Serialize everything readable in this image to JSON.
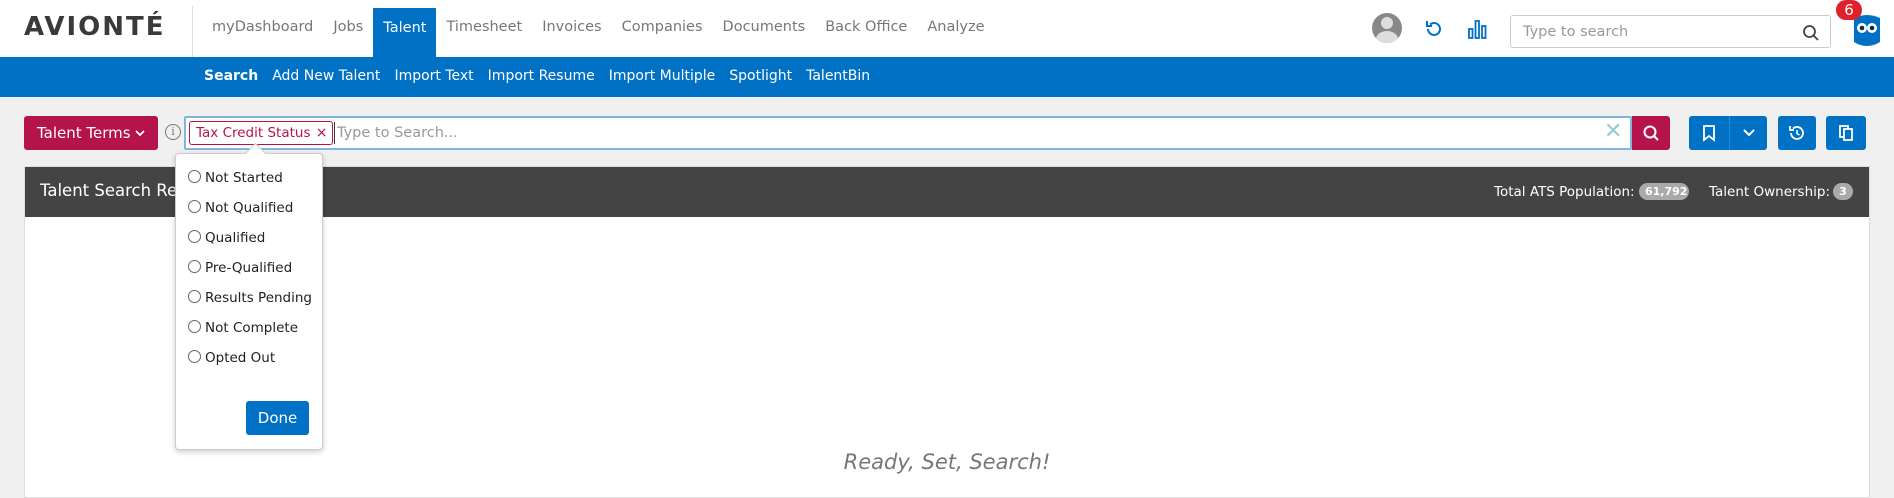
{
  "app": {
    "logo": "AVIONTÉ"
  },
  "nav": {
    "items": [
      "myDashboard",
      "Jobs",
      "Talent",
      "Timesheet",
      "Invoices",
      "Companies",
      "Documents",
      "Back Office",
      "Analyze"
    ],
    "active": "Talent"
  },
  "top_search": {
    "placeholder": "Type to search"
  },
  "notifications": {
    "count": "6"
  },
  "subnav": {
    "items": [
      "Search",
      "Add New Talent",
      "Import Text",
      "Import Resume",
      "Import Multiple",
      "Spotlight",
      "TalentBin"
    ],
    "active": "Search"
  },
  "search": {
    "terms_label": "Talent Terms",
    "chip_label": "Tax Credit Status",
    "chip_remove": "×",
    "placeholder": "Type to Search...",
    "clear": "✕"
  },
  "panel": {
    "title": "Talent Search Re",
    "total_label": "Total ATS Population:",
    "total_value": "61,792",
    "ownership_label": "Talent Ownership:",
    "ownership_value": "3",
    "empty_message": "Ready, Set, Search!"
  },
  "dropdown": {
    "options": [
      "Not Started",
      "Not Qualified",
      "Qualified",
      "Pre-Qualified",
      "Results Pending",
      "Not Complete",
      "Opted Out"
    ],
    "done_label": "Done"
  },
  "colors": {
    "primary": "#0071c5",
    "accent": "#b5134b",
    "header_dark": "#444444"
  },
  "icons": [
    "refresh-icon",
    "bar-chart-icon",
    "search-icon",
    "owl-icon",
    "bookmark-icon",
    "chevron-down-icon",
    "history-icon",
    "copy-icon",
    "info-icon"
  ]
}
